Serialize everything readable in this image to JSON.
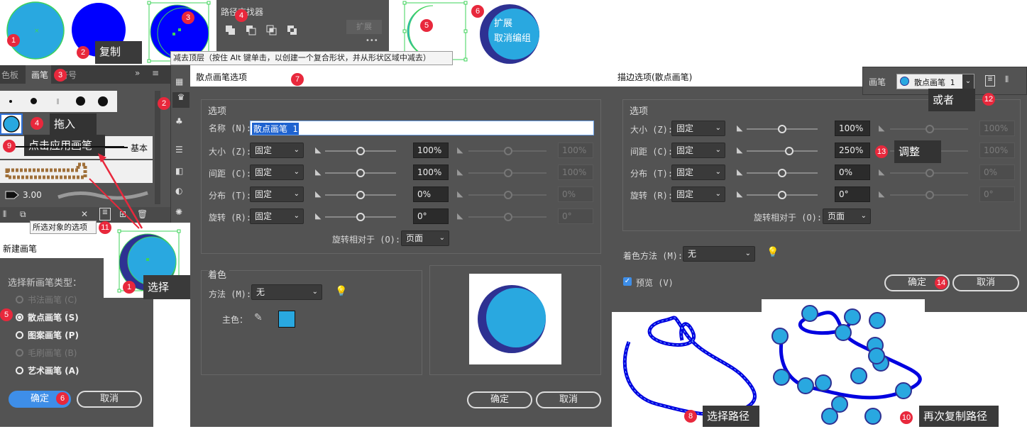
{
  "badges": {
    "b1": "1",
    "b2": "2",
    "b3": "3",
    "b4": "4",
    "b5": "5",
    "b6": "6",
    "b7": "7",
    "b8": "8",
    "b9": "9",
    "b10": "10",
    "b11": "11",
    "b12": "12",
    "b13": "13",
    "b14": "14"
  },
  "tips": {
    "copy": "复制",
    "drag_in": "拖入",
    "click_apply": "点击应用画笔",
    "select": "选择",
    "or": "或者",
    "adjust": "调整",
    "select_path": "选择路径",
    "copy_path_again": "再次复制路径",
    "expand": "扩展",
    "ungroup": "取消编组"
  },
  "pathfinder": {
    "title": "路径查找器",
    "expand_button": "扩展",
    "more": "•••",
    "tooltip": "减去顶层（按住 Alt 键单击，以创建一个复合形状，并从形状区域中减去）"
  },
  "brushes_panel": {
    "tabs": [
      "色板",
      "画笔",
      "符号"
    ],
    "basic_label": "基本",
    "stroke_size": "3.00",
    "tooltip": "所选对象的选项"
  },
  "new_brush": {
    "title": "新建画笔",
    "prompt": "选择新画笔类型：",
    "options": [
      {
        "label": "书法画笔 (C)",
        "enabled": false,
        "selected": false
      },
      {
        "label": "散点画笔 (S)",
        "enabled": true,
        "selected": true
      },
      {
        "label": "图案画笔 (P)",
        "enabled": true,
        "selected": false
      },
      {
        "label": "毛刷画笔 (B)",
        "enabled": false,
        "selected": false
      },
      {
        "label": "艺术画笔 (A)",
        "enabled": true,
        "selected": false
      }
    ],
    "ok": "确定",
    "cancel": "取消"
  },
  "scatter_dialog": {
    "title": "散点画笔选项",
    "options_section": "选项",
    "name_label": "名称 (N):",
    "name_value": "散点画笔 1",
    "rows": [
      {
        "label": "大小 (Z):",
        "mode": "固定",
        "value": "100%",
        "value2": "100%"
      },
      {
        "label": "间距 (C):",
        "mode": "固定",
        "value": "100%",
        "value2": "100%"
      },
      {
        "label": "分布 (T):",
        "mode": "固定",
        "value": "0%",
        "value2": "0%"
      },
      {
        "label": "旋转 (R):",
        "mode": "固定",
        "value": "0°",
        "value2": "0°"
      }
    ],
    "rotate_relative_label": "旋转相对于 (O):",
    "rotate_relative_value": "页面",
    "coloring_section": "着色",
    "method_label": "方法 (M):",
    "method_value": "无",
    "key_color_label": "主色：",
    "ok": "确定",
    "cancel": "取消"
  },
  "stroke_dialog": {
    "title": "描边选项(散点画笔)",
    "options_section": "选项",
    "rows": [
      {
        "label": "大小 (Z):",
        "mode": "固定",
        "value": "100%",
        "value2": "100%"
      },
      {
        "label": "间距 (C):",
        "mode": "固定",
        "value": "250%",
        "value2": "100%"
      },
      {
        "label": "分布 (T):",
        "mode": "固定",
        "value": "0%",
        "value2": "0%"
      },
      {
        "label": "旋转 (R):",
        "mode": "固定",
        "value": "0°",
        "value2": "0°"
      }
    ],
    "rotate_relative_label": "旋转相对于 (O):",
    "rotate_relative_value": "页面",
    "coloring_label": "着色方法 (M):",
    "coloring_value": "无",
    "preview_label": "预览 (V)",
    "ok": "确定",
    "cancel": "取消"
  },
  "control_bar": {
    "brush_label": "画笔",
    "brush_value": "散点画笔 1"
  },
  "colors": {
    "panel": "#535353",
    "fill_blue": "#29a8e0",
    "deep_blue": "#0000ff",
    "navy": "#2e3192",
    "selection_green": "#3ed35a",
    "badge_red": "#e8283c"
  }
}
